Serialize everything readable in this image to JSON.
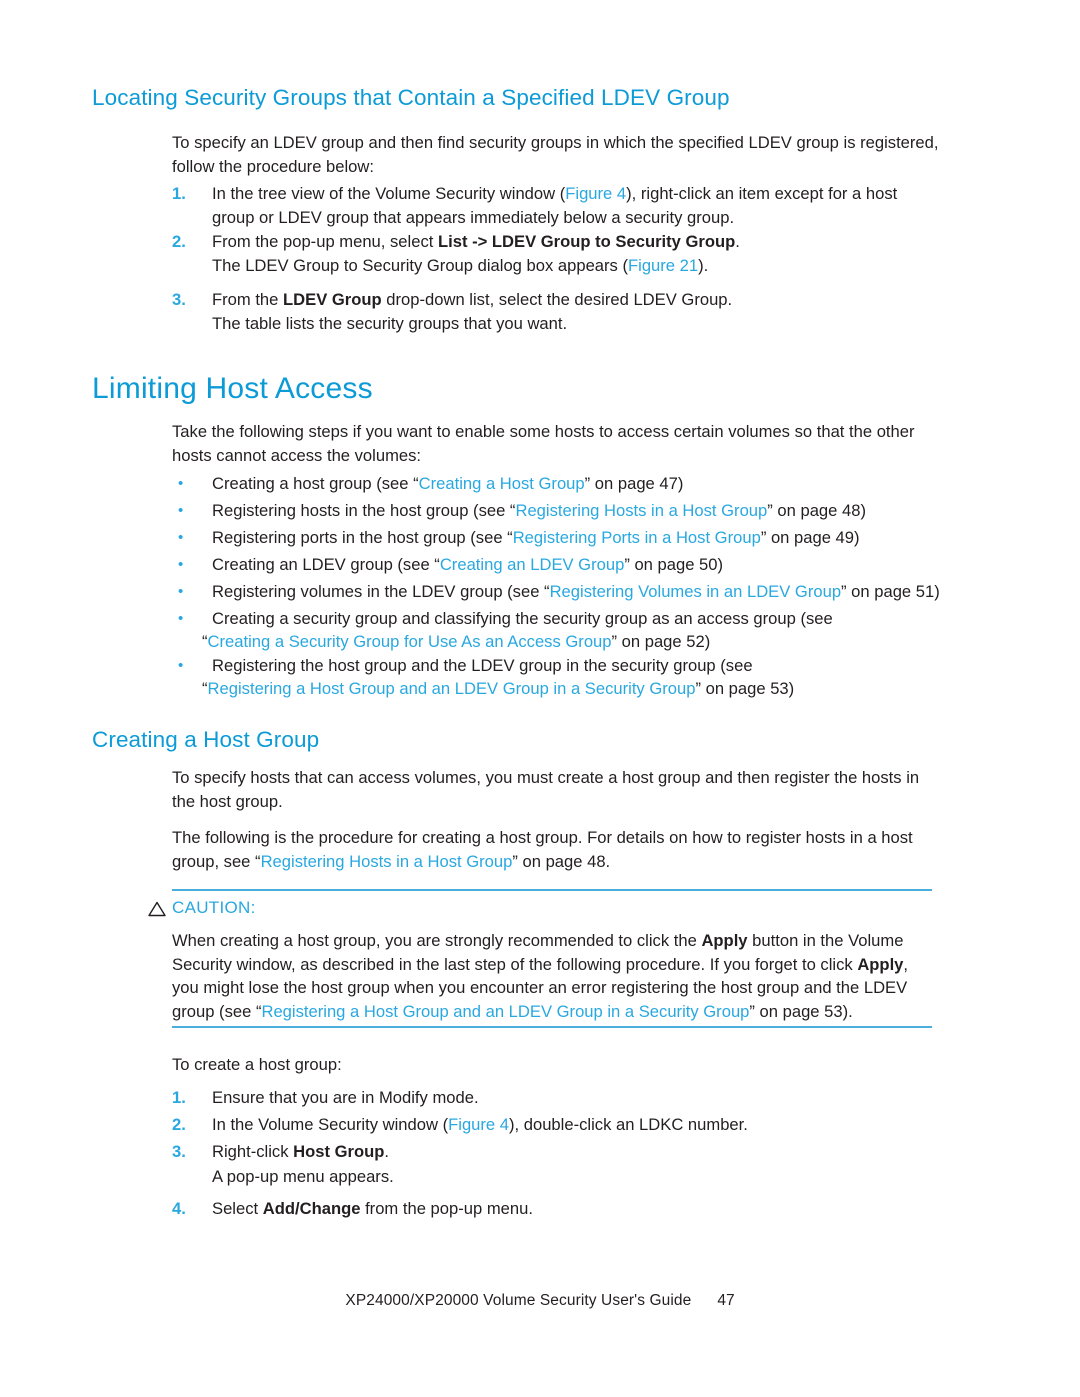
{
  "section_1": {
    "heading": "Locating Security Groups that Contain a Specified LDEV Group",
    "intro": "To specify an LDEV group and then find security groups in which the specified LDEV group is registered, follow the procedure below:",
    "steps": [
      {
        "number": "1.",
        "text_a": "In the tree view of the Volume Security window (",
        "link": "Figure 4",
        "text_b": "), right-click an item except for a host group or LDEV group that appears immediately below a security group."
      },
      {
        "number": "2.",
        "text_a": "From the pop-up menu, select ",
        "bold": "List -> LDEV Group to Security Group",
        "text_b": ".",
        "sub_a": "The LDEV Group to Security Group dialog box appears (",
        "sub_link": "Figure 21",
        "sub_b": ")."
      },
      {
        "number": "3.",
        "text_a": "From the ",
        "bold": "LDEV Group",
        "text_b": " drop-down list, select the desired LDEV Group.",
        "sub": "The table lists the security groups that you want."
      }
    ]
  },
  "section_2": {
    "heading": "Limiting Host Access",
    "intro": "Take the following steps if you want to enable some hosts to access certain volumes so that the other hosts cannot access the volumes:",
    "bullet": "•",
    "bullets": [
      {
        "pre": "Creating a host group (see “",
        "link": "Creating a Host Group",
        "post": "” on page 47)"
      },
      {
        "pre": "Registering hosts in the host group (see “",
        "link": "Registering Hosts in a Host Group",
        "post": "” on page 48)"
      },
      {
        "pre": "Registering ports in the host group (see “",
        "link": "Registering Ports in a Host Group",
        "post": "” on page 49)"
      },
      {
        "pre": "Creating an LDEV group (see “",
        "link": "Creating an LDEV Group",
        "post": "” on page 50)"
      },
      {
        "pre": "Registering volumes in the LDEV group (see “",
        "link": "Registering Volumes in an LDEV Group",
        "post": "” on page 51)"
      },
      {
        "pre": "Creating a security group and classifying the security group as an access group (see",
        "cont_open": "“",
        "link": "Creating a Security Group for Use As an Access Group",
        "post": "” on page 52)"
      },
      {
        "pre": "Registering the host group and the LDEV group in the security group (see",
        "cont_open": "“",
        "link": "Registering a Host Group and an LDEV Group in a Security Group",
        "post": "” on page 53)"
      }
    ]
  },
  "section_3": {
    "heading": "Creating a Host Group",
    "para_1": "To specify hosts that can access volumes, you must create a host group and then register the hosts in the host group.",
    "para_2_a": "The following is the procedure for creating a host group. For details on how to register hosts in a host group, see “",
    "para_2_link": "Registering Hosts in a Host Group",
    "para_2_b": "” on page 48.",
    "caution": {
      "icon": "warning-triangle-icon",
      "label": "CAUTION:",
      "text_1": "When creating a host group, you are strongly recommended to click the ",
      "bold_1": "Apply",
      "text_2": " button in the Volume Security window, as described in the last step of the following procedure. If you forget to click ",
      "bold_2": "Apply",
      "text_3": ", you might lose the host group when you encounter an error registering the host group and the LDEV group (see “",
      "link": "Registering a Host Group and an LDEV Group in a Security Group",
      "text_4": "” on page 53)."
    },
    "lead_in": "To create a host group:",
    "steps": [
      {
        "number": "1.",
        "text": "Ensure that you are in Modify mode."
      },
      {
        "number": "2.",
        "text_a": "In the Volume Security window (",
        "link": "Figure 4",
        "text_b": "), double-click an LDKC number."
      },
      {
        "number": "3.",
        "text_a": "Right-click ",
        "bold": "Host Group",
        "text_b": ".",
        "sub": "A pop-up menu appears."
      },
      {
        "number": "4.",
        "text_a": "Select ",
        "bold": "Add/Change",
        "text_b": " from the pop-up menu."
      }
    ]
  },
  "footer": {
    "title": "XP24000/XP20000 Volume Security User's Guide",
    "page_number": "47"
  },
  "colors": {
    "heading": "#0c9bd7",
    "link": "#29a8e0",
    "rule": "#4aaede",
    "body": "#231f20"
  }
}
